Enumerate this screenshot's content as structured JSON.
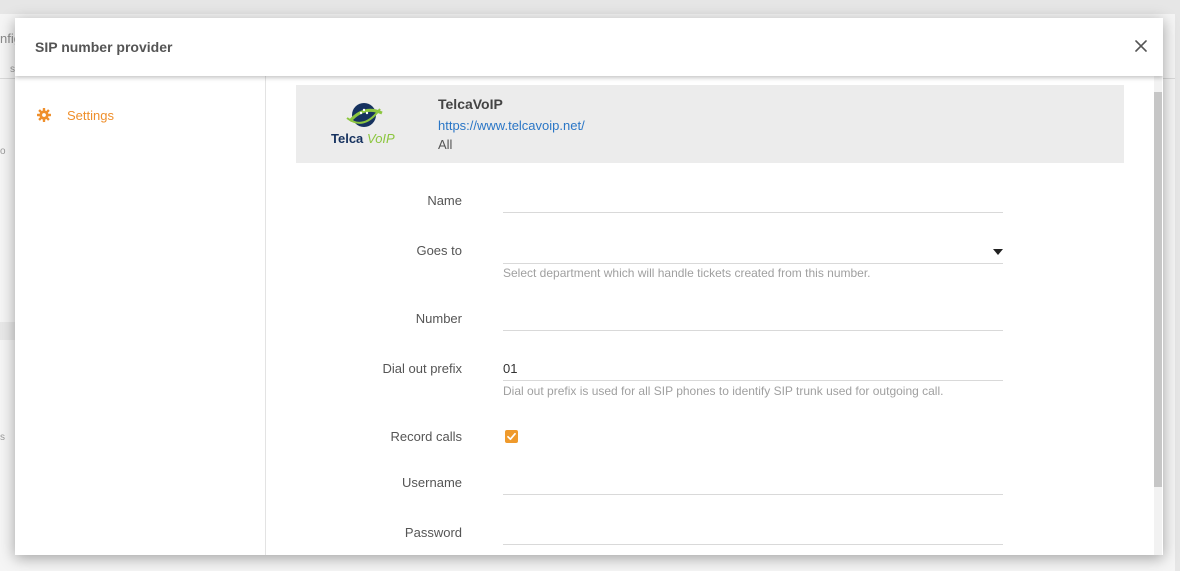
{
  "background": {
    "fragments": [
      "nfig",
      "s",
      "o",
      "s"
    ]
  },
  "modal": {
    "title": "SIP number provider",
    "close_label": "×"
  },
  "sidebar": {
    "items": [
      {
        "label": "Settings",
        "icon": "gear-icon",
        "active": true
      }
    ]
  },
  "provider": {
    "name": "TelcaVoIP",
    "url": "https://www.telcavoip.net/",
    "scope": "All",
    "logo": {
      "text_dark": "Telca",
      "text_green": "VoIP"
    }
  },
  "form": {
    "name": {
      "label": "Name",
      "value": ""
    },
    "goes_to": {
      "label": "Goes to",
      "value": "",
      "hint": "Select department which will handle tickets created from this number."
    },
    "number": {
      "label": "Number",
      "value": ""
    },
    "dial_out_prefix": {
      "label": "Dial out prefix",
      "value": "01",
      "hint": "Dial out prefix is used for all SIP phones to identify SIP trunk used for outgoing call."
    },
    "record_calls": {
      "label": "Record calls",
      "checked": true
    },
    "username": {
      "label": "Username",
      "value": ""
    },
    "password": {
      "label": "Password",
      "value": ""
    }
  },
  "colors": {
    "accent": "#ef8f2b",
    "link": "#2a76c6",
    "provider_bg": "#ececec"
  }
}
